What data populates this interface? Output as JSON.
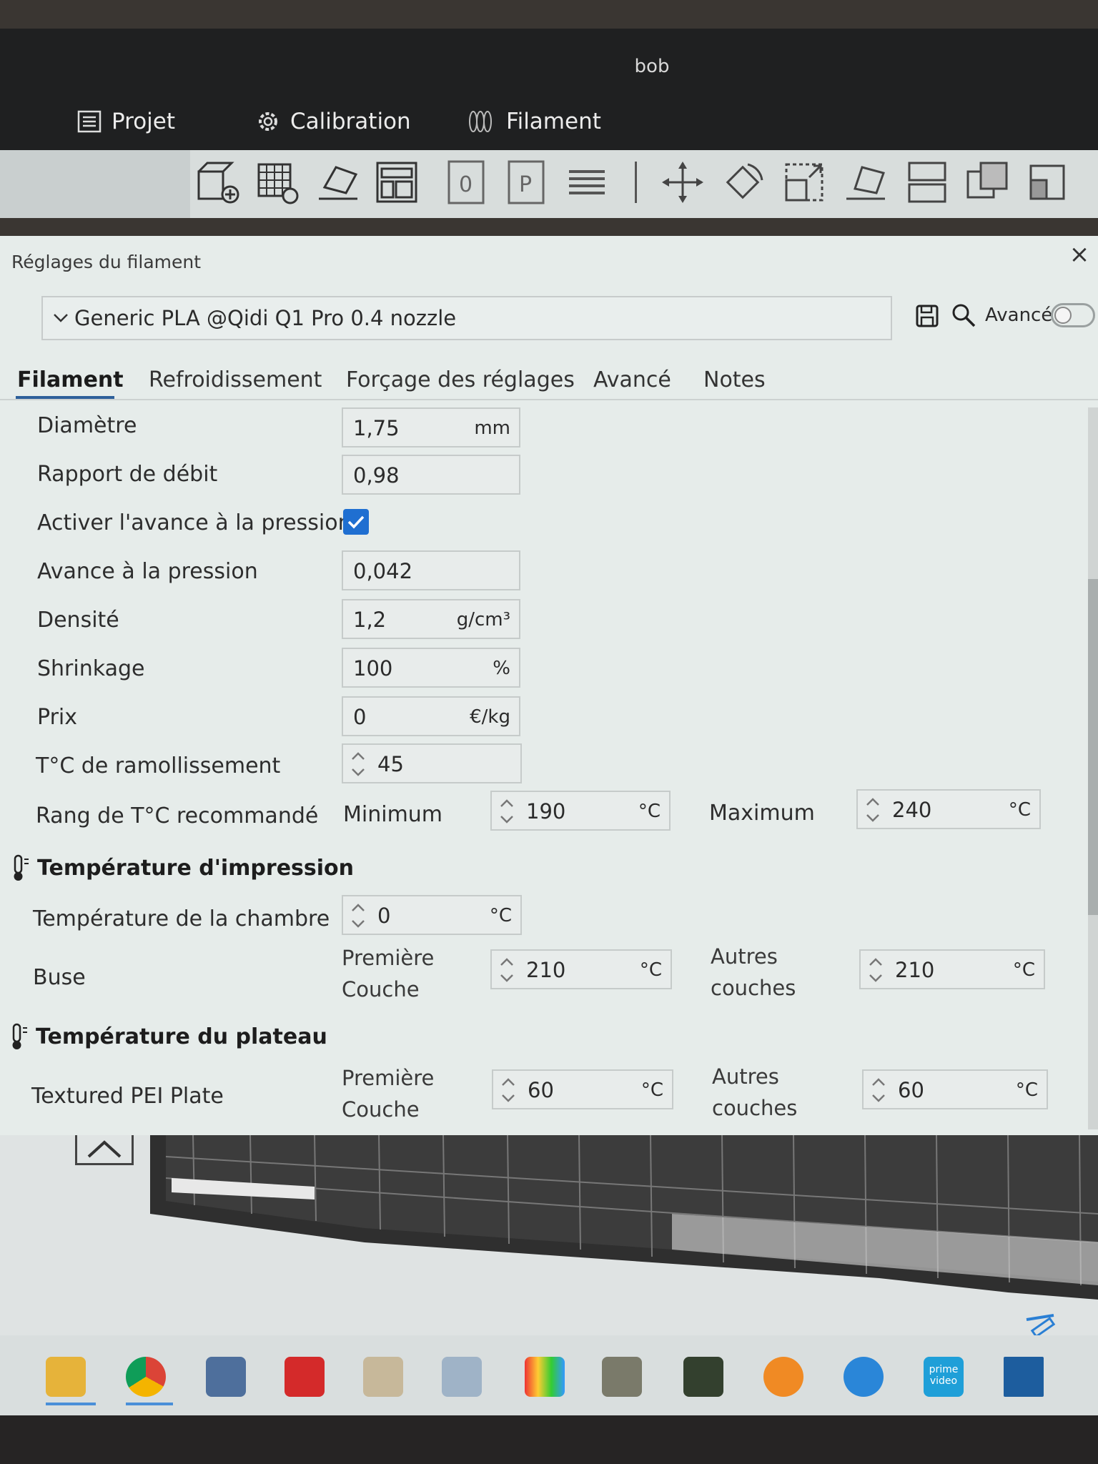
{
  "window": {
    "title": "bob"
  },
  "menu": {
    "project": {
      "label": "Projet",
      "icon": "list-icon"
    },
    "calibration": {
      "label": "Calibration",
      "icon": "gear-icon"
    },
    "filament": {
      "label": "Filament",
      "icon": "filament-spool-icon"
    }
  },
  "toolbar": {
    "icons": [
      "add-cube-icon",
      "add-plate-icon",
      "auto-orient-icon",
      "arrange-icon",
      "slice-0-icon",
      "slice-p-icon",
      "layers-icon",
      "move-icon",
      "rotate-icon",
      "scale-icon",
      "lay-on-face-icon",
      "split-icon",
      "boolean-icon",
      "support-paint-icon"
    ]
  },
  "dialog": {
    "title": "Réglages du filament",
    "close": "×",
    "preset": "Generic PLA @Qidi Q1 Pro 0.4 nozzle",
    "advanced_label": "Avancé",
    "advanced_toggle": false,
    "tabs": [
      "Filament",
      "Refroidissement",
      "Forçage des réglages",
      "Avancé",
      "Notes"
    ],
    "active_tab": "Filament"
  },
  "settings": {
    "diameter": {
      "label": "Diamètre",
      "value": "1,75",
      "unit": "mm"
    },
    "flow_ratio": {
      "label": "Rapport de débit",
      "value": "0,98"
    },
    "pressure_advance_enable": {
      "label": "Activer l'avance à la pression",
      "checked": true
    },
    "pressure_advance": {
      "label": "Avance à la pression",
      "value": "0,042"
    },
    "density": {
      "label": "Densité",
      "value": "1,2",
      "unit": "g/cm³"
    },
    "shrinkage": {
      "label": "Shrinkage",
      "value": "100",
      "unit": "%"
    },
    "price": {
      "label": "Prix",
      "value": "0",
      "unit": "€/kg"
    },
    "softening_temp": {
      "label": "T°C de ramollissement",
      "value": "45"
    },
    "recommended_range": {
      "label": "Rang de T°C recommandé",
      "min_label": "Minimum",
      "min": "190",
      "max_label": "Maximum",
      "max": "240",
      "unit": "°C"
    }
  },
  "print_temp": {
    "title": "Température d'impression",
    "chamber": {
      "label": "Température de la chambre",
      "value": "0",
      "unit": "°C"
    },
    "nozzle": {
      "label": "Buse",
      "first_label_1": "Première",
      "first_label_2": "Couche",
      "first": "210",
      "other_label_1": "Autres",
      "other_label_2": "couches",
      "other": "210",
      "unit": "°C"
    }
  },
  "bed_temp": {
    "title": "Température du plateau",
    "plate": {
      "label": "Textured PEI Plate",
      "first_label_1": "Première",
      "first_label_2": "Couche",
      "first": "60",
      "other_label_1": "Autres",
      "other_label_2": "couches",
      "other": "60",
      "unit": "°C"
    }
  },
  "taskbar": {
    "apps": [
      "file-explorer-icon",
      "chrome-icon",
      "app-icon",
      "acrobat-icon",
      "paint-icon",
      "app-icon-2",
      "media-icon",
      "gimp-icon",
      "app-icon-3",
      "app-icon-4",
      "app-icon-5",
      "prime-video-icon",
      "app-icon-6"
    ],
    "prime_text_1": "prime",
    "prime_text_2": "video"
  },
  "colors": {
    "accent": "#1f6fd1",
    "dialog_bg": "#e6ecea",
    "titlebar_bg": "#1f2021"
  }
}
